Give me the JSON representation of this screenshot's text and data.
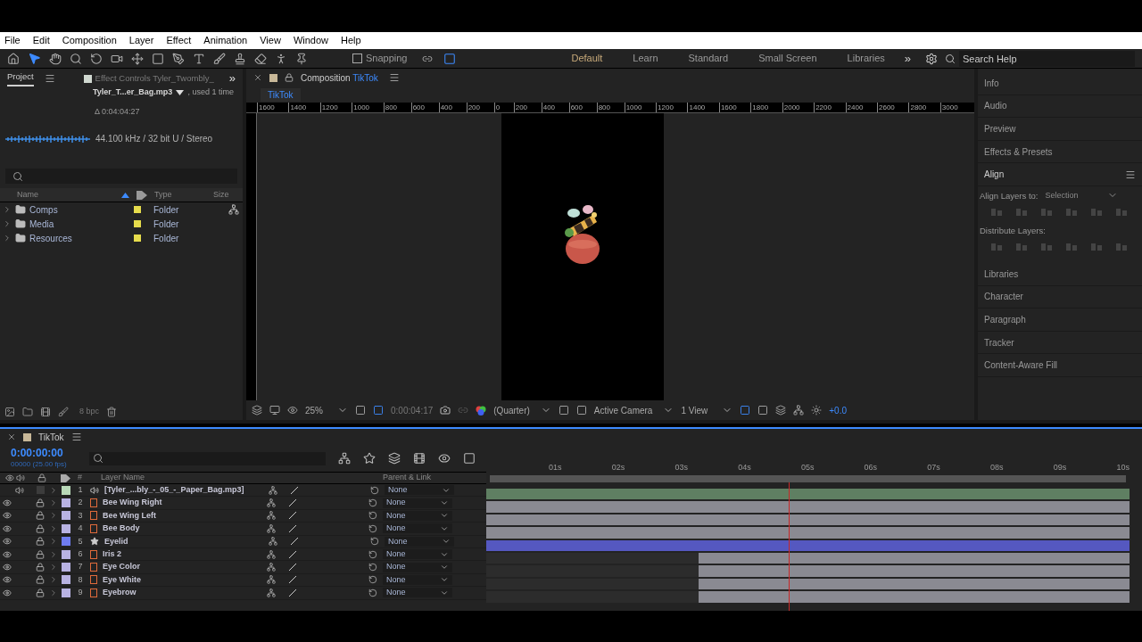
{
  "menu": [
    "File",
    "Edit",
    "Composition",
    "Layer",
    "Effect",
    "Animation",
    "View",
    "Window",
    "Help"
  ],
  "tools": [
    {
      "kind": "home",
      "selected": false
    },
    {
      "kind": "select",
      "selected": true
    },
    {
      "kind": "hand",
      "selected": false
    },
    {
      "kind": "zoom",
      "selected": false
    },
    {
      "kind": "rotate",
      "selected": false
    },
    {
      "kind": "camera",
      "selected": false
    },
    {
      "kind": "anchor",
      "selected": false
    },
    {
      "kind": "rect",
      "selected": false
    },
    {
      "kind": "pen",
      "selected": false
    },
    {
      "kind": "type",
      "selected": false
    },
    {
      "kind": "brush",
      "selected": false
    },
    {
      "kind": "stamp",
      "selected": false
    },
    {
      "kind": "eraser",
      "selected": false
    },
    {
      "kind": "roto",
      "selected": false
    },
    {
      "kind": "pin",
      "selected": false
    }
  ],
  "snapping": {
    "label": "Snapping",
    "checked": false
  },
  "workspaces": [
    {
      "label": "Default",
      "selected": true
    },
    {
      "label": "Learn",
      "selected": false
    },
    {
      "label": "Standard",
      "selected": false
    },
    {
      "label": "Small Screen",
      "selected": false
    },
    {
      "label": "Libraries",
      "selected": false
    }
  ],
  "more": "»",
  "search_help": {
    "placeholder": "Search Help"
  },
  "project": {
    "tabs": [
      {
        "label": "Project",
        "selected": true
      },
      {
        "label": "Effect Controls Tyler_Twombly_",
        "selected": false
      }
    ],
    "more": "»",
    "file_name": "Tyler_T...er_Bag.mp3",
    "usage": ", used 1 time",
    "duration": "Δ 0:04:04:27",
    "audio_info": "44.100 kHz / 32 bit U / Stereo",
    "columns": [
      "Name",
      "Type",
      "Size"
    ],
    "items": [
      {
        "name": "Comps",
        "type": "Folder",
        "color": "#e6dc4c"
      },
      {
        "name": "Media",
        "type": "Folder",
        "color": "#e6dc4c"
      },
      {
        "name": "Resources",
        "type": "Folder",
        "color": "#e6dc4c"
      }
    ],
    "bpc": "8 bpc"
  },
  "viewer": {
    "tab_prefix": "Composition",
    "tab_name": "TikTok",
    "subtab": "TikTok",
    "ruler": [
      "1600",
      "1400",
      "1200",
      "1000",
      "800",
      "600",
      "400",
      "200",
      "0",
      "200",
      "400",
      "600",
      "800",
      "1000",
      "1200",
      "1400",
      "1600",
      "1800",
      "2000",
      "2200",
      "2400",
      "2600",
      "2800",
      "3000"
    ],
    "zoom": "25%",
    "time": "0:00:04:17",
    "resolution": "(Quarter)",
    "camera": "Active Camera",
    "views": "1 View",
    "exposure": "+0.0"
  },
  "right_panels": [
    {
      "label": "Info",
      "expanded": false
    },
    {
      "label": "Audio",
      "expanded": false
    },
    {
      "label": "Preview",
      "expanded": false
    },
    {
      "label": "Effects & Presets",
      "expanded": false
    },
    {
      "label": "Align",
      "expanded": true
    },
    {
      "label": "Libraries",
      "expanded": false
    },
    {
      "label": "Character",
      "expanded": false
    },
    {
      "label": "Paragraph",
      "expanded": false
    },
    {
      "label": "Tracker",
      "expanded": false
    },
    {
      "label": "Content-Aware Fill",
      "expanded": false
    }
  ],
  "align": {
    "align_label": "Align Layers to:",
    "align_to": "Selection",
    "distribute_label": "Distribute Layers:"
  },
  "timeline": {
    "tab": "TikTok",
    "timecode": "0:00:00:00",
    "frames": "00000 (25.00 fps)",
    "ticks": [
      "01s",
      "02s",
      "03s",
      "04s",
      "05s",
      "06s",
      "07s",
      "08s",
      "09s",
      "10s"
    ],
    "columns": [
      "#",
      "Layer Name",
      "Parent & Link"
    ],
    "layers": [
      {
        "number": "1",
        "name": "[Tyler_...bly_-_05_-_Paper_Bag.mp3]",
        "kind": "audio",
        "color": "#b8d8b8",
        "locked": false,
        "trimmed": false,
        "parent": "None"
      },
      {
        "number": "2",
        "name": "Bee Wing Right",
        "kind": "shape",
        "color": "#b8b2e2",
        "locked": true,
        "trimmed": false,
        "parent": "None"
      },
      {
        "number": "3",
        "name": "Bee Wing Left",
        "kind": "shape",
        "color": "#b8b2e2",
        "locked": true,
        "trimmed": false,
        "parent": "None"
      },
      {
        "number": "4",
        "name": "Bee Body",
        "kind": "shape",
        "color": "#b8b2e2",
        "locked": true,
        "trimmed": false,
        "parent": "None"
      },
      {
        "number": "5",
        "name": "Eyelid",
        "kind": "null",
        "color": "#6f7cf0",
        "locked": true,
        "trimmed": false,
        "parent": "None"
      },
      {
        "number": "6",
        "name": "Iris 2",
        "kind": "shape",
        "color": "#b8b2e2",
        "locked": true,
        "trimmed": true,
        "parent": "None"
      },
      {
        "number": "7",
        "name": "Eye Color",
        "kind": "shape",
        "color": "#b8b2e2",
        "locked": true,
        "trimmed": true,
        "parent": "None"
      },
      {
        "number": "8",
        "name": "Eye White",
        "kind": "shape",
        "color": "#b8b2e2",
        "locked": true,
        "trimmed": true,
        "parent": "None"
      },
      {
        "number": "9",
        "name": "Eyebrow",
        "kind": "shape",
        "color": "#b8b2e2",
        "locked": true,
        "trimmed": true,
        "parent": "None"
      }
    ]
  }
}
